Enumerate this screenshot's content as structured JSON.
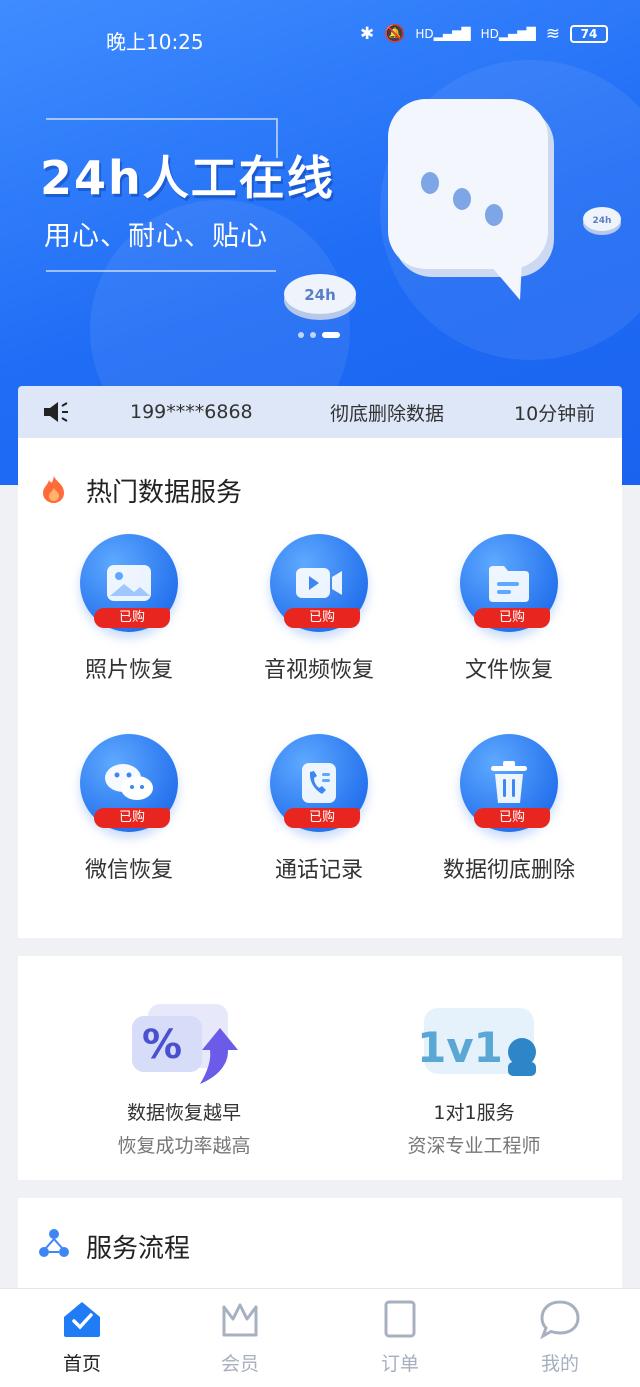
{
  "status_bar": {
    "time": "晚上10:25",
    "battery": "74"
  },
  "banner": {
    "title": "24h人工在线",
    "subtitle": "用心、耐心、贴心",
    "chip_text": "24h"
  },
  "notice": {
    "phone": "199****6868",
    "action": "彻底删除数据",
    "time_ago": "10分钟前"
  },
  "hot_services": {
    "title": "热门数据服务",
    "badge": "已购",
    "items": [
      {
        "label": "照片恢复",
        "icon": "photo-icon"
      },
      {
        "label": "音视频恢复",
        "icon": "video-icon"
      },
      {
        "label": "文件恢复",
        "icon": "file-icon"
      },
      {
        "label": "微信恢复",
        "icon": "wechat-icon"
      },
      {
        "label": "通话记录",
        "icon": "phone-record-icon"
      },
      {
        "label": "数据彻底删除",
        "icon": "trash-icon"
      }
    ]
  },
  "features": [
    {
      "line1": "数据恢复越早",
      "line2": "恢复成功率越高",
      "icon": "percent-arrow-icon"
    },
    {
      "line1": "1对1服务",
      "line2": "资深专业工程师",
      "icon": "one-on-one-icon",
      "art_text": "1v1"
    }
  ],
  "flow": {
    "title": "服务流程"
  },
  "tabbar": {
    "items": [
      {
        "label": "首页",
        "icon": "home-icon",
        "active": true
      },
      {
        "label": "会员",
        "icon": "crown-icon",
        "active": false
      },
      {
        "label": "订单",
        "icon": "order-icon",
        "active": false
      },
      {
        "label": "我的",
        "icon": "chat-bubble-icon",
        "active": false
      }
    ]
  },
  "colors": {
    "primary": "#1f6cf5",
    "badge_red": "#e8251f",
    "notice_bg": "#dde7f8"
  }
}
